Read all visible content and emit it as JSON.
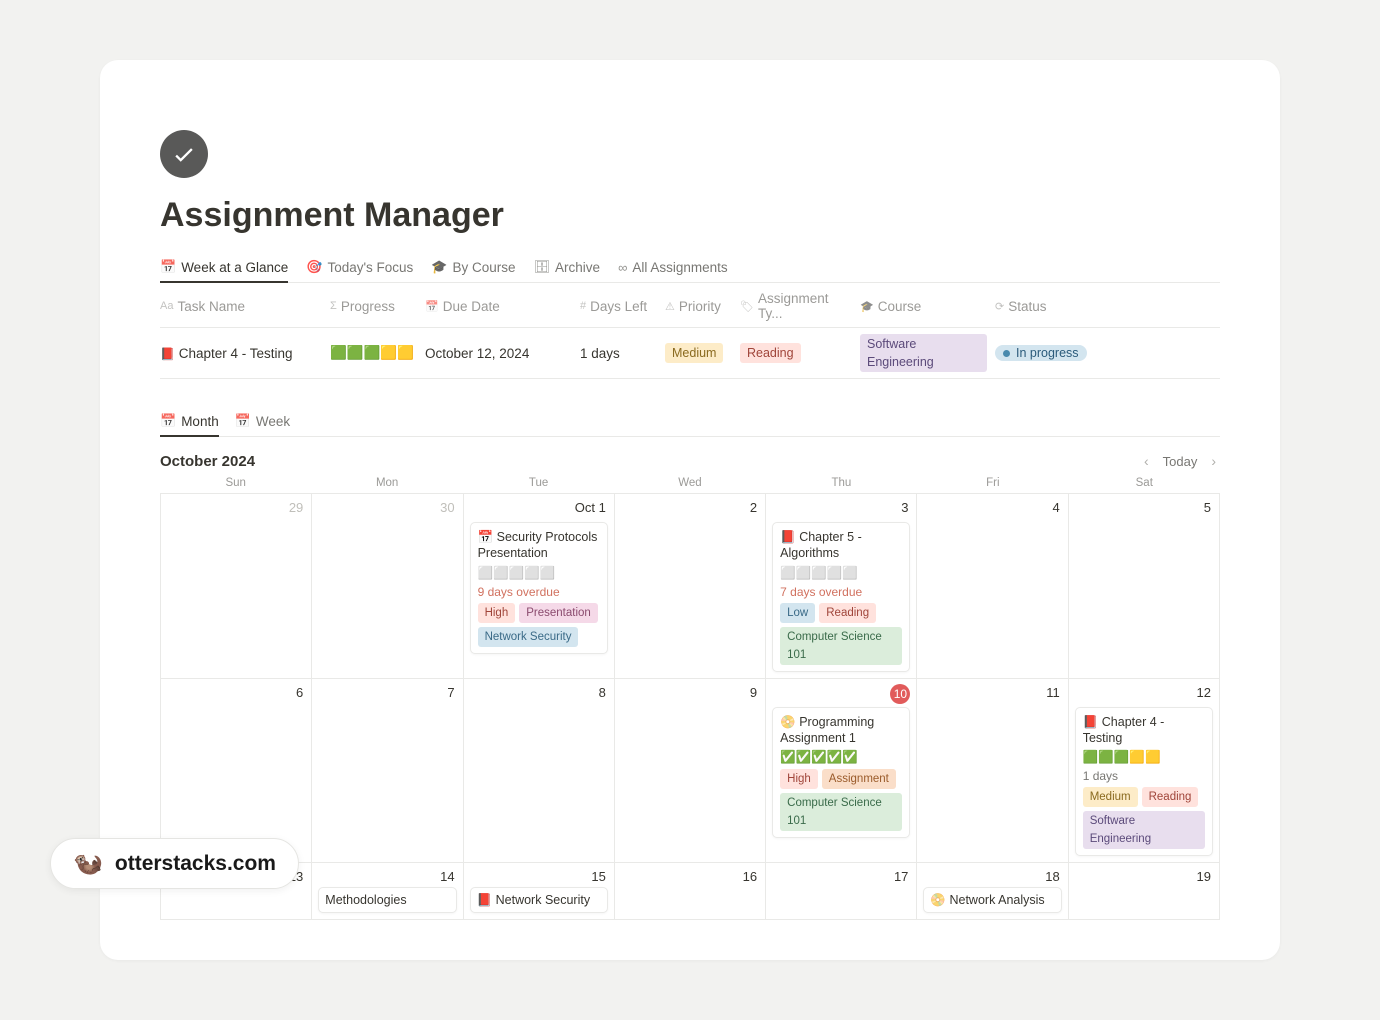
{
  "page": {
    "title": "Assignment Manager"
  },
  "tabs": {
    "week": "Week at a Glance",
    "today": "Today's Focus",
    "course": "By Course",
    "archive": "Archive",
    "all": "All Assignments"
  },
  "columns": {
    "task": "Task Name",
    "progress": "Progress",
    "due": "Due Date",
    "days": "Days Left",
    "priority": "Priority",
    "type": "Assignment Ty...",
    "course": "Course",
    "status": "Status"
  },
  "row": {
    "icon": "📕",
    "name": "Chapter 4 - Testing",
    "progress": "🟩🟩🟩🟨🟨",
    "due": "October 12, 2024",
    "days": "1 days",
    "priority": "Medium",
    "type": "Reading",
    "course": "Software Engineering",
    "status": "In progress"
  },
  "viewtabs": {
    "month": "Month",
    "week": "Week"
  },
  "calendar": {
    "label": "October 2024",
    "today": "Today",
    "weekdays": [
      "Sun",
      "Mon",
      "Tue",
      "Wed",
      "Thu",
      "Fri",
      "Sat"
    ],
    "days_row1": [
      "29",
      "30",
      "Oct 1",
      "2",
      "3",
      "4",
      "5"
    ],
    "days_row2": [
      "6",
      "7",
      "8",
      "9",
      "10",
      "11",
      "12"
    ],
    "days_row3": [
      "13",
      "14",
      "15",
      "16",
      "17",
      "18",
      "19"
    ]
  },
  "events": {
    "oct1": {
      "icon": "📅",
      "title": "Security Protocols Presentation",
      "progress": "⬜⬜⬜⬜⬜",
      "overdue": "9 days overdue",
      "priority": "High",
      "type": "Presentation",
      "course": "Network Security"
    },
    "oct3": {
      "icon": "📕",
      "title": "Chapter 5 - Algorithms",
      "progress": "⬜⬜⬜⬜⬜",
      "overdue": "7 days overdue",
      "priority": "Low",
      "type": "Reading",
      "course": "Computer Science 101"
    },
    "oct10": {
      "icon": "📀",
      "title": "Programming Assignment 1",
      "progress": "✅✅✅✅✅",
      "priority": "High",
      "type": "Assignment",
      "course": "Computer Science 101"
    },
    "oct12": {
      "icon": "📕",
      "title": "Chapter 4 - Testing",
      "progress": "🟩🟩🟩🟨🟨",
      "meta": "1 days",
      "priority": "Medium",
      "type": "Reading",
      "course": "Software Engineering"
    },
    "oct14": {
      "title": "Methodologies"
    },
    "oct15": {
      "icon": "📕",
      "title": "Network Security"
    },
    "oct18": {
      "icon": "📀",
      "title": "Network Analysis"
    }
  },
  "watermark": {
    "text": "otterstacks.com"
  }
}
